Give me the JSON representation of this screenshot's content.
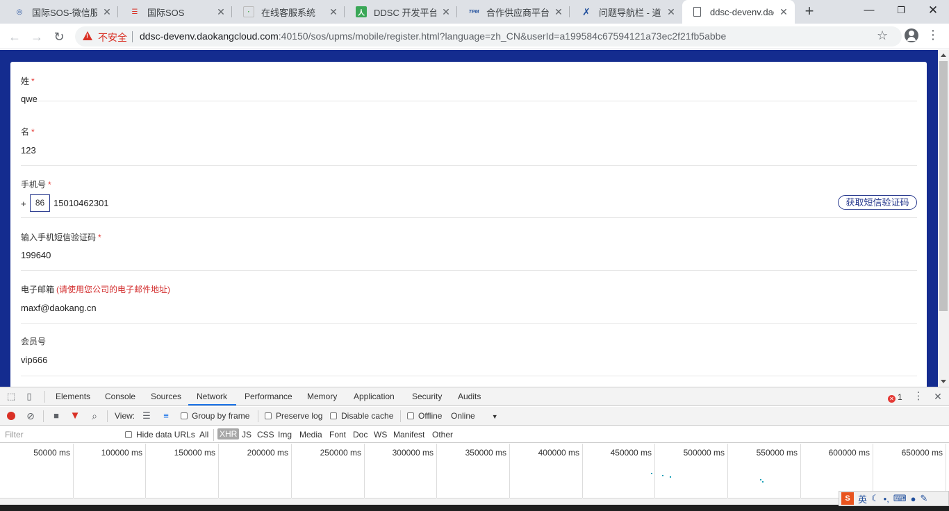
{
  "browser": {
    "tabs": [
      {
        "title": "国际SOS-微信服务",
        "favicon": "sos-logo-icon",
        "active": false
      },
      {
        "title": "国际SOS",
        "favicon": "sos-doc-icon",
        "active": false
      },
      {
        "title": "在线客服系统",
        "favicon": "chat-icon",
        "active": false
      },
      {
        "title": "DDSC 开发平台",
        "favicon": "ddsc-icon",
        "active": false
      },
      {
        "title": "合作供应商平台-意",
        "favicon": "tpm-icon",
        "active": false
      },
      {
        "title": "问题导航栏 - 道康",
        "favicon": "jira-icon",
        "active": false
      },
      {
        "title": "ddsc-devenv.dao",
        "favicon": "page-icon",
        "active": true
      }
    ],
    "security_label": "不安全",
    "url_host": "ddsc-devenv.daokangcloud.com",
    "url_rest": ":40150/sos/upms/mobile/register.html?language=zh_CN&userId=a199584c67594121a73ec2f21fb5abbe"
  },
  "form": {
    "last_name": {
      "label": "姓",
      "required_mark": "*",
      "value": "qwe"
    },
    "first_name": {
      "label": "名",
      "required_mark": "*",
      "value": "123"
    },
    "phone": {
      "label": "手机号",
      "required_mark": "*",
      "plus": "+",
      "country_code": "86",
      "value": "15010462301",
      "sms_button": "获取短信验证码"
    },
    "sms_code": {
      "label": "输入手机短信验证码",
      "required_mark": "*",
      "value": "199640"
    },
    "email": {
      "label": "电子邮箱",
      "hint": "(请使用您公司的电子邮件地址)",
      "value": "maxf@daokang.cn"
    },
    "member_no": {
      "label": "会员号",
      "value": "vip666"
    }
  },
  "devtools": {
    "tabs": [
      "Elements",
      "Console",
      "Sources",
      "Network",
      "Performance",
      "Memory",
      "Application",
      "Security",
      "Audits"
    ],
    "active_tab": "Network",
    "error_count": "1",
    "toolbar": {
      "view_label": "View:",
      "group_by_frame": "Group by frame",
      "preserve_log": "Preserve log",
      "disable_cache": "Disable cache",
      "offline": "Offline",
      "throttle": "Online"
    },
    "filter": {
      "placeholder": "Filter",
      "hide_data_urls": "Hide data URLs",
      "types": [
        "All",
        "XHR",
        "JS",
        "CSS",
        "Img",
        "Media",
        "Font",
        "Doc",
        "WS",
        "Manifest",
        "Other"
      ],
      "active_type": "XHR"
    },
    "timeline_labels": [
      "50000 ms",
      "100000 ms",
      "150000 ms",
      "200000 ms",
      "250000 ms",
      "300000 ms",
      "350000 ms",
      "400000 ms",
      "450000 ms",
      "500000 ms",
      "550000 ms",
      "600000 ms",
      "650000 ms"
    ]
  },
  "ime": {
    "mode": "英"
  }
}
